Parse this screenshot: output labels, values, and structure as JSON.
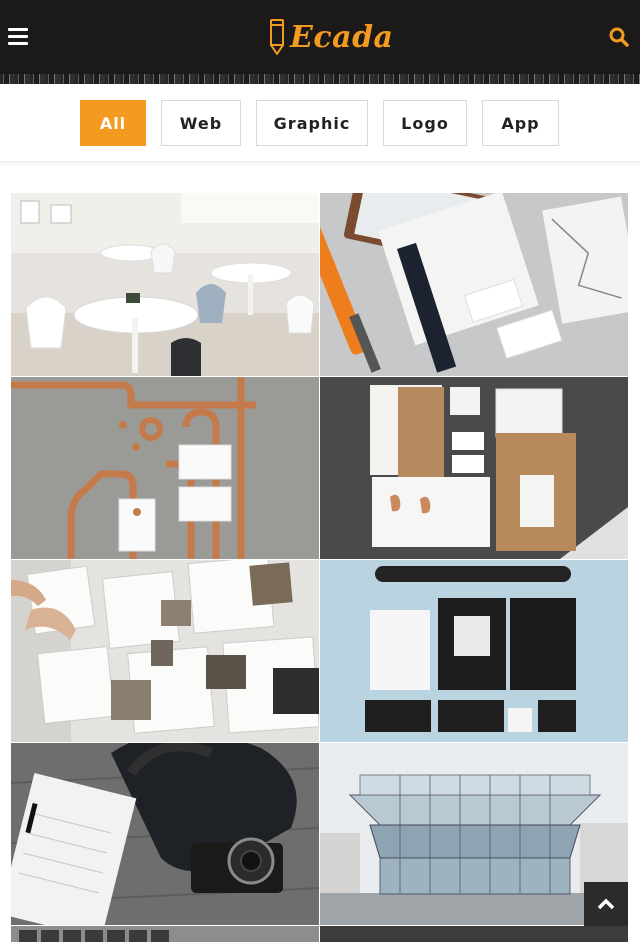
{
  "header": {
    "logo_text": "Ecada",
    "menu_icon": "hamburger-menu-icon",
    "search_icon": "search-icon",
    "accent_color": "#f49a20",
    "background_color": "#1c1a19"
  },
  "filters": {
    "items": [
      {
        "label": "All",
        "active": true
      },
      {
        "label": "Web",
        "active": false
      },
      {
        "label": "Graphic",
        "active": false
      },
      {
        "label": "Logo",
        "active": false
      },
      {
        "label": "App",
        "active": false
      }
    ]
  },
  "gallery": {
    "items": [
      {
        "subject": "white cafe tables and chairs"
      },
      {
        "subject": "orange pen and stationery branding mockup"
      },
      {
        "subject": "copper pipes with business cards"
      },
      {
        "subject": "kraft paper stationery set"
      },
      {
        "subject": "hands arranging photo prints on table"
      },
      {
        "subject": "black and white corporate identity set"
      },
      {
        "subject": "notebook, bag and camera on wood"
      },
      {
        "subject": "modern glass building"
      },
      {
        "subject": "laptop keyboard"
      },
      {
        "subject": "dark workspace"
      }
    ]
  },
  "back_to_top_icon": "chevron-up-icon"
}
